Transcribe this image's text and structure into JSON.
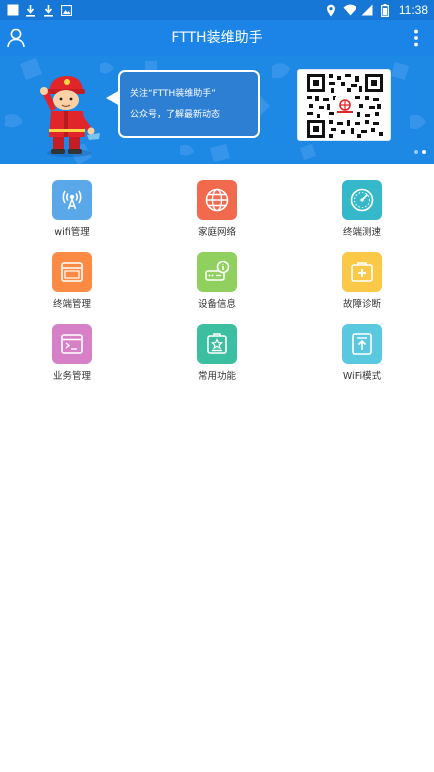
{
  "status_bar": {
    "time": "11:38",
    "left_icons": [
      "square-icon",
      "download-icon",
      "download-icon",
      "image-icon"
    ],
    "right_icons": [
      "location-icon",
      "wifi-icon",
      "signal-icon",
      "battery-icon"
    ]
  },
  "app_bar": {
    "title": "FTTH装维助手",
    "left_icon": "user-icon",
    "right_icon": "more-vertical-icon"
  },
  "banner": {
    "line1": "关注“FTTH装维助手”",
    "line2": "公众号，了解最新动态",
    "pager_count": 2,
    "pager_active": 2
  },
  "grid": [
    {
      "label": "wifi管理",
      "icon": "wifi-antenna-icon",
      "color": "#5aa7ea"
    },
    {
      "label": "家庭网络",
      "icon": "globe-icon",
      "color": "#f26a4d"
    },
    {
      "label": "终端测速",
      "icon": "speedometer-icon",
      "color": "#35b8c9"
    },
    {
      "label": "终端管理",
      "icon": "window-icon",
      "color": "#fb8a44"
    },
    {
      "label": "设备信息",
      "icon": "router-info-icon",
      "color": "#8fd05f"
    },
    {
      "label": "故障诊断",
      "icon": "first-aid-icon",
      "color": "#fbc847"
    },
    {
      "label": "业务管理",
      "icon": "terminal-icon",
      "color": "#d680c8"
    },
    {
      "label": "常用功能",
      "icon": "star-box-icon",
      "color": "#3cbea0"
    },
    {
      "label": "WiFi模式",
      "icon": "upload-box-icon",
      "color": "#5ac8de"
    }
  ],
  "colors": {
    "status_bar": "#1677d6",
    "app_bar": "#1b84e6",
    "banner": "#1e88e5"
  }
}
